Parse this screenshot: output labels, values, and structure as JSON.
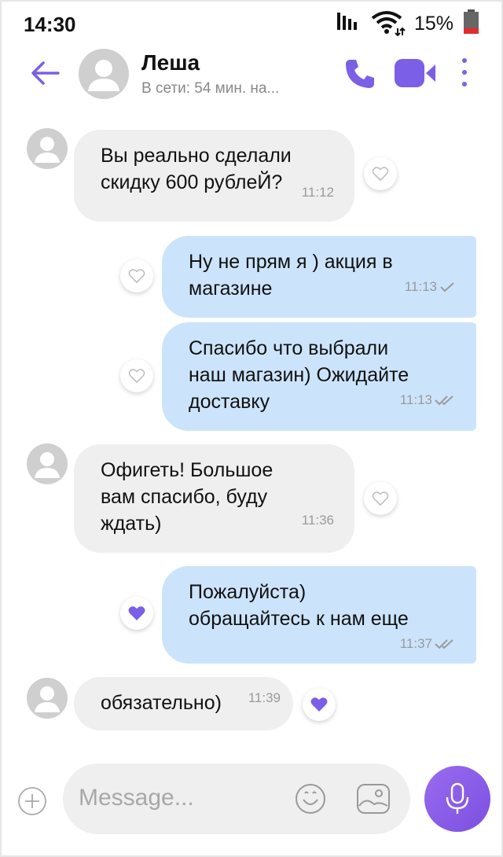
{
  "status_bar": {
    "time": "14:30",
    "battery": "15%",
    "icons": [
      "signal-icon",
      "wifi-icon",
      "battery-icon"
    ]
  },
  "header": {
    "contact_name": "Леша",
    "contact_status": "В сети: 54 мин. на...",
    "icons": [
      "back-arrow-icon",
      "phone-icon",
      "video-icon",
      "more-icon"
    ]
  },
  "colors": {
    "accent": "#7b5fe6",
    "incoming_bubble": "#efefef",
    "outgoing_bubble": "#cce4fb",
    "mic_button": "#8a5cea"
  },
  "messages": [
    {
      "direction": "incoming",
      "text": "Вы реально сделали\nскидку 600 рублеЙ?",
      "time": "11:12",
      "liked": false
    },
    {
      "direction": "outgoing",
      "text": "Ну не прям я ) акция в\nмагазине",
      "time": "11:13",
      "read": false,
      "liked": false
    },
    {
      "direction": "outgoing",
      "text": "Спасибо что выбрали\nнаш магазин) Ожидайте\nдоставку",
      "time": "11:13",
      "read": true,
      "liked": false
    },
    {
      "direction": "incoming",
      "text": "Офигеть! Большое\nвам спасибо, буду\nждать)",
      "time": "11:36",
      "liked": false
    },
    {
      "direction": "outgoing",
      "text": "Пожалуйста)\nобращайтесь к нам еще",
      "time": "11:37",
      "read": true,
      "liked": true
    },
    {
      "direction": "incoming",
      "text": "обязательно)",
      "time": "11:39",
      "liked": true
    }
  ],
  "composer": {
    "placeholder": "Message...",
    "icons": [
      "plus-icon",
      "emoji-icon",
      "gallery-icon",
      "microphone-icon"
    ]
  }
}
